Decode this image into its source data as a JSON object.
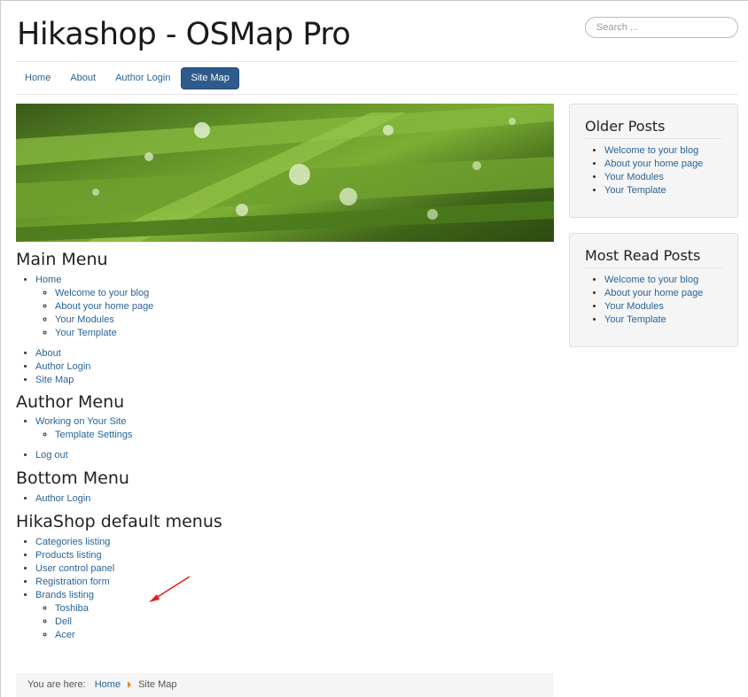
{
  "site": {
    "title": "Hikashop - OSMap Pro"
  },
  "search": {
    "placeholder": "Search ..."
  },
  "nav": {
    "items": [
      "Home",
      "About",
      "Author Login",
      "Site Map"
    ],
    "active_index": 3
  },
  "main": {
    "sections": [
      {
        "title": "Main Menu",
        "groups": [
          {
            "item": "Home",
            "children": [
              "Welcome to your blog",
              "About your home page",
              "Your Modules",
              "Your Template"
            ]
          }
        ],
        "rest": [
          "About",
          "Author Login",
          "Site Map"
        ]
      },
      {
        "title": "Author Menu",
        "groups": [
          {
            "item": "Working on Your Site",
            "children": [
              "Template Settings"
            ]
          }
        ],
        "rest": [
          "Log out"
        ]
      },
      {
        "title": "Bottom Menu",
        "groups": [],
        "rest": [
          "Author Login"
        ]
      },
      {
        "title": "HikaShop default menus",
        "items": [
          "Categories listing",
          "Products listing",
          "User control panel",
          "Registration form",
          "Brands listing"
        ],
        "brands": [
          "Toshiba",
          "Dell",
          "Acer"
        ]
      }
    ]
  },
  "breadcrumb": {
    "prefix": "You are here:",
    "home": "Home",
    "current": "Site Map"
  },
  "sidebar": {
    "older": {
      "title": "Older Posts",
      "items": [
        "Welcome to your blog",
        "About your home page",
        "Your Modules",
        "Your Template"
      ]
    },
    "most_read": {
      "title": "Most Read Posts",
      "items": [
        "Welcome to your blog",
        "About your home page",
        "Your Modules",
        "Your Template"
      ]
    }
  },
  "colors": {
    "link": "#2a6496",
    "nav_active": "#2e5b8b",
    "annotation_arrow": "#e02020"
  }
}
